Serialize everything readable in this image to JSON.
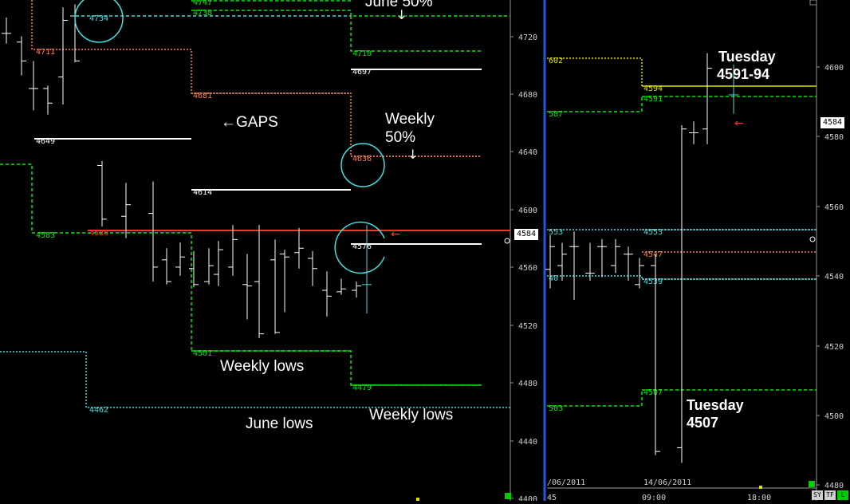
{
  "chart_data": [
    {
      "type": "line",
      "panel": "left",
      "y_axis_ticks": [
        "4720",
        "4680",
        "4640",
        "4600",
        "4560",
        "4520",
        "4480",
        "4440",
        "4400"
      ],
      "ylim": [
        4400,
        4745
      ],
      "current_price_label": "4584",
      "levels": [
        {
          "label": "4747",
          "value": 4747,
          "color": "#00ee00",
          "style": "dashed"
        },
        {
          "label": "4738",
          "value": 4738,
          "color": "#00ee00",
          "style": "dashed"
        },
        {
          "label": "4734",
          "value": 4734,
          "color": "#40e0e0",
          "style": "dashed"
        },
        {
          "label": "4711",
          "value": 4711,
          "color": "#ff7f50",
          "style": "dotted"
        },
        {
          "label": "4710",
          "value": 4710,
          "color": "#00ee00",
          "style": "dashed"
        },
        {
          "label": "4697",
          "value": 4697,
          "color": "#ffffff",
          "style": "solid"
        },
        {
          "label": "4681",
          "value": 4681,
          "color": "#ff7f50",
          "style": "dotted"
        },
        {
          "label": "4649",
          "value": 4649,
          "color": "#ffffff",
          "style": "solid"
        },
        {
          "label": "4636",
          "value": 4636,
          "color": "#ff7f50",
          "style": "dotted"
        },
        {
          "label": "4614",
          "value": 4614,
          "color": "#ffffff",
          "style": "solid"
        },
        {
          "label": "4586",
          "value": 4586,
          "color": "#ff3030",
          "style": "solid"
        },
        {
          "label": "4583",
          "value": 4583,
          "color": "#00ee00",
          "style": "dashed"
        },
        {
          "label": "4576",
          "value": 4576,
          "color": "#ffffff",
          "style": "solid"
        },
        {
          "label": "4501",
          "value": 4501,
          "color": "#00ee00",
          "style": "dashed"
        },
        {
          "label": "4479",
          "value": 4479,
          "color": "#00ee00",
          "style": "dashed"
        },
        {
          "label": "4462",
          "value": 4462,
          "color": "#40e0e0",
          "style": "dotted"
        }
      ],
      "annotations": [
        "June 50%",
        "←GAPS",
        "Weekly",
        "50%",
        "Weekly lows",
        "June lows",
        "Weekly lows"
      ],
      "bars": [
        {
          "high": 4733,
          "low": 4715,
          "open": 4722,
          "close": 4722
        },
        {
          "high": 4720,
          "low": 4693,
          "open": 4716,
          "close": 4703
        },
        {
          "high": 4703,
          "low": 4669,
          "open": 4684,
          "close": 4684
        },
        {
          "high": 4686,
          "low": 4666,
          "open": 4684,
          "close": 4674
        },
        {
          "high": 4740,
          "low": 4673,
          "open": 4692,
          "close": 4731
        },
        {
          "high": 4742,
          "low": 4702,
          "open": 4734,
          "close": 4703
        },
        {
          "high": 4634,
          "low": 4589,
          "open": 4631,
          "close": 4594
        },
        {
          "high": 4619,
          "low": 4581,
          "open": 4596,
          "close": 4604
        },
        {
          "high": 4620,
          "low": 4551,
          "open": 4598,
          "close": 4561
        },
        {
          "high": 4574,
          "low": 4549,
          "open": 4566,
          "close": 4551
        },
        {
          "high": 4578,
          "low": 4555,
          "open": 4561,
          "close": 4568
        },
        {
          "high": 4572,
          "low": 4547,
          "open": 4560,
          "close": 4549
        },
        {
          "high": 4574,
          "low": 4549,
          "open": 4551,
          "close": 4562
        },
        {
          "high": 4579,
          "low": 4548,
          "open": 4556,
          "close": 4573
        },
        {
          "high": 4590,
          "low": 4555,
          "open": 4561,
          "close": 4580
        },
        {
          "high": 4570,
          "low": 4525,
          "open": 4549,
          "close": 4548
        },
        {
          "high": 4590,
          "low": 4512,
          "open": 4551,
          "close": 4515
        },
        {
          "high": 4580,
          "low": 4515,
          "open": 4566,
          "close": 4516
        },
        {
          "high": 4573,
          "low": 4530,
          "open": 4570,
          "close": 4568
        },
        {
          "high": 4588,
          "low": 4560,
          "open": 4571,
          "close": 4574
        },
        {
          "high": 4572,
          "low": 4548,
          "open": 4567,
          "close": 4560
        },
        {
          "high": 4558,
          "low": 4527,
          "open": 4545,
          "close": 4541
        },
        {
          "high": 4553,
          "low": 4542,
          "open": 4544,
          "close": 4546
        },
        {
          "high": 4551,
          "low": 4540,
          "open": 4545,
          "close": 4548
        },
        {
          "high": 4590,
          "low": 4529,
          "open": 4549,
          "close": 4549,
          "color": "#40e0e0"
        }
      ]
    },
    {
      "type": "line",
      "panel": "right",
      "y_axis_ticks": [
        "4600",
        "4580",
        "4560",
        "4540",
        "4520",
        "4500",
        "4480"
      ],
      "ylim": [
        4480,
        4612
      ],
      "current_price_label": "4584",
      "x_tick_labels": [
        "/06/2011",
        "14/06/2011",
        "45",
        "09:00",
        "18:00"
      ],
      "levels": [
        {
          "label": "602",
          "value": 4602,
          "color": "#e0e000",
          "style": "dotted"
        },
        {
          "label": "4594",
          "value": 4594,
          "color": "#e0e000",
          "style": "dotted"
        },
        {
          "label": "4591",
          "value": 4591,
          "color": "#00ee00",
          "style": "dashed"
        },
        {
          "label": "587",
          "value": 4587,
          "color": "#00ee00",
          "style": "dashed"
        },
        {
          "label": "553",
          "value": 4553,
          "color": "#40e0e0",
          "style": "dotted"
        },
        {
          "label": "4553",
          "value": 4553,
          "color": "#40e0e0",
          "style": "dotted"
        },
        {
          "label": "4547",
          "value": 4547,
          "color": "#ff7f50",
          "style": "dotted"
        },
        {
          "label": "40",
          "value": 4540,
          "color": "#40e0e0",
          "style": "dotted"
        },
        {
          "label": "4539",
          "value": 4539,
          "color": "#40e0e0",
          "style": "dotted"
        },
        {
          "label": "4507",
          "value": 4507,
          "color": "#00ee00",
          "style": "dashed"
        },
        {
          "label": "503",
          "value": 4503,
          "color": "#00ee00",
          "style": "dashed"
        }
      ],
      "annotations": [
        "Tuesday",
        "4591-94",
        "Tuesday",
        "4507"
      ],
      "bars": [
        {
          "high": 4550,
          "low": 4536,
          "open": 4541,
          "close": 4547
        },
        {
          "high": 4548,
          "low": 4538,
          "open": 4542,
          "close": 4545
        },
        {
          "high": 4551,
          "low": 4533,
          "open": 4547,
          "close": 4547
        },
        {
          "high": 4548,
          "low": 4538,
          "open": 4540,
          "close": 4540
        },
        {
          "high": 4549,
          "low": 4539,
          "open": 4547,
          "close": 4547
        },
        {
          "high": 4549,
          "low": 4540,
          "open": 4542,
          "close": 4547
        },
        {
          "high": 4547,
          "low": 4538,
          "open": 4545,
          "close": 4545
        },
        {
          "high": 4544,
          "low": 4536,
          "open": 4537,
          "close": 4542
        },
        {
          "high": 4545,
          "low": 4492,
          "open": 4542,
          "close": 4493
        },
        {
          "high": 4579,
          "low": 4490,
          "open": 4494,
          "close": 4578
        },
        {
          "high": 4580,
          "low": 4574,
          "open": 4577,
          "close": 4577
        },
        {
          "high": 4598,
          "low": 4574,
          "open": 4578,
          "close": 4594
        },
        {
          "high": 4595,
          "low": 4582,
          "open": 4587,
          "close": 4587,
          "color": "#40e0e0"
        }
      ]
    }
  ],
  "ui": {
    "buttons": [
      "SY",
      "TF",
      "L"
    ]
  }
}
